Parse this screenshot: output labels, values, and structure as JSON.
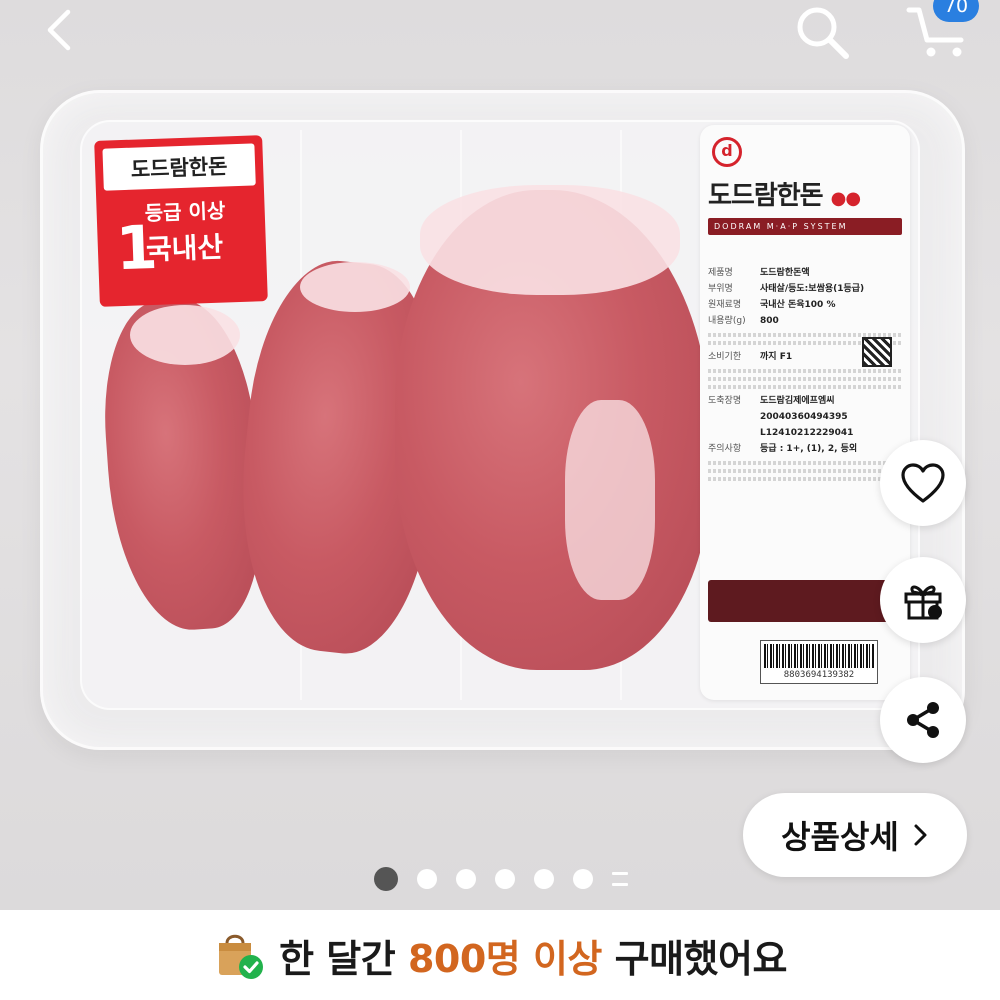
{
  "top_bar": {
    "back_icon": "chevron-left-icon",
    "search_icon": "search-icon",
    "cart_icon": "cart-icon",
    "cart_count": "70",
    "cart_badge_color": "#2a7fe0"
  },
  "product_image": {
    "badge": {
      "brand": "도드람한돈",
      "grade_number": "1",
      "grade_text": "등급 이상",
      "origin": "국내산"
    },
    "label": {
      "logo_letter": "d",
      "brand": "도드람한돈",
      "band_text": "DODRAM  M·A·P SYSTEM",
      "rows": [
        {
          "key": "제품명",
          "value": "도드람한돈액"
        },
        {
          "key": "부위명",
          "value": "사태살/등도:보쌈용(1등급)"
        },
        {
          "key": "원재료명",
          "value": "국내산 돈육100 %"
        },
        {
          "key": "내용량(g)",
          "value": "800"
        },
        {
          "key": "소비기한",
          "value": "까지   F1"
        }
      ],
      "row_codes": [
        {
          "key": "도축장명",
          "value": "도드람김제에프엠씨"
        },
        {
          "key": "",
          "value": "20040360494395"
        },
        {
          "key": "",
          "value": "L12410212229041"
        },
        {
          "key": "주의사항",
          "value": "등급 : 1+, (1), 2, 등외"
        }
      ],
      "barcode": "8803694139382"
    },
    "pager": {
      "total_dots": 6,
      "active_index": 0
    }
  },
  "floating": {
    "like_icon": "heart-icon",
    "gift_icon": "gift-icon",
    "share_icon": "share-icon"
  },
  "detail_button": {
    "label": "상품상세",
    "icon": "chevron-right-icon"
  },
  "banner": {
    "icon": "shopping-bag-check-icon",
    "prefix": "한 달간",
    "highlight": "800명 이상",
    "suffix": "구매했어요",
    "highlight_color": "#d2661f"
  }
}
